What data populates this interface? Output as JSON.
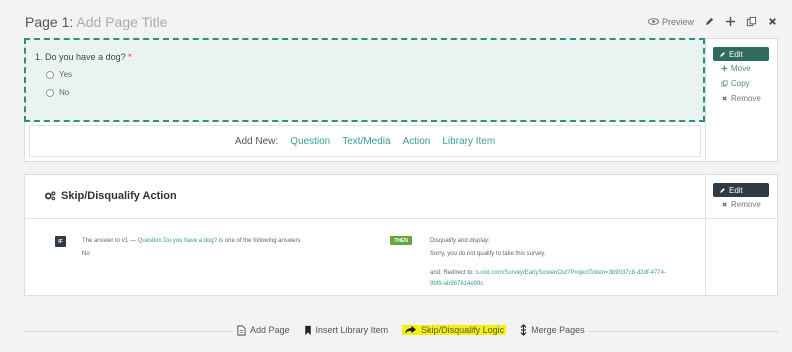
{
  "header": {
    "page_label": "Page 1:",
    "title_placeholder": "Add Page Title",
    "preview_label": "Preview"
  },
  "question": {
    "number": "1.",
    "text": "Do you have a dog?",
    "required_mark": "*",
    "options": [
      "Yes",
      "No"
    ],
    "actions": {
      "edit": "Edit",
      "move": "Move",
      "copy": "Copy",
      "remove": "Remove"
    }
  },
  "add_new": {
    "label": "Add New:",
    "items": [
      "Question",
      "Text/Media",
      "Action",
      "Library Item"
    ]
  },
  "skip_action": {
    "title": "Skip/Disqualify Action",
    "edit": "Edit",
    "remove": "Remove",
    "if_badge": "IF",
    "condition_prefix": "The answer to #1 —",
    "condition_question": "Question Do you have a dog?",
    "condition_suffix": "is one of the following answers",
    "condition_answer": "No",
    "then_badge": "THEN",
    "action_line1": "Disqualify and display:",
    "action_line2": "Sorry, you do not qualify to take this survey.",
    "redirect_prefix": "and: Redirect to:",
    "redirect_url_1": "s.cint.com/Survey/EarlyScreenOut?ProjectToken=3b9037c8-d2df-4774-",
    "redirect_url_2": "9bf9-ab987814e99c"
  },
  "bottom_bar": {
    "add_page": "Add Page",
    "insert_library": "Insert Library Item",
    "skip_logic": "Skip/Disqualify Logic",
    "merge_pages": "Merge Pages"
  },
  "colors": {
    "accent_teal": "#3a9e93",
    "question_bg": "#e9f3f0",
    "dashed_border": "#2f8f87",
    "edit_button": "#2f6b5f",
    "dark_button": "#2f3a45",
    "then_badge": "#6aa63a",
    "highlight": "#f4f20c"
  }
}
